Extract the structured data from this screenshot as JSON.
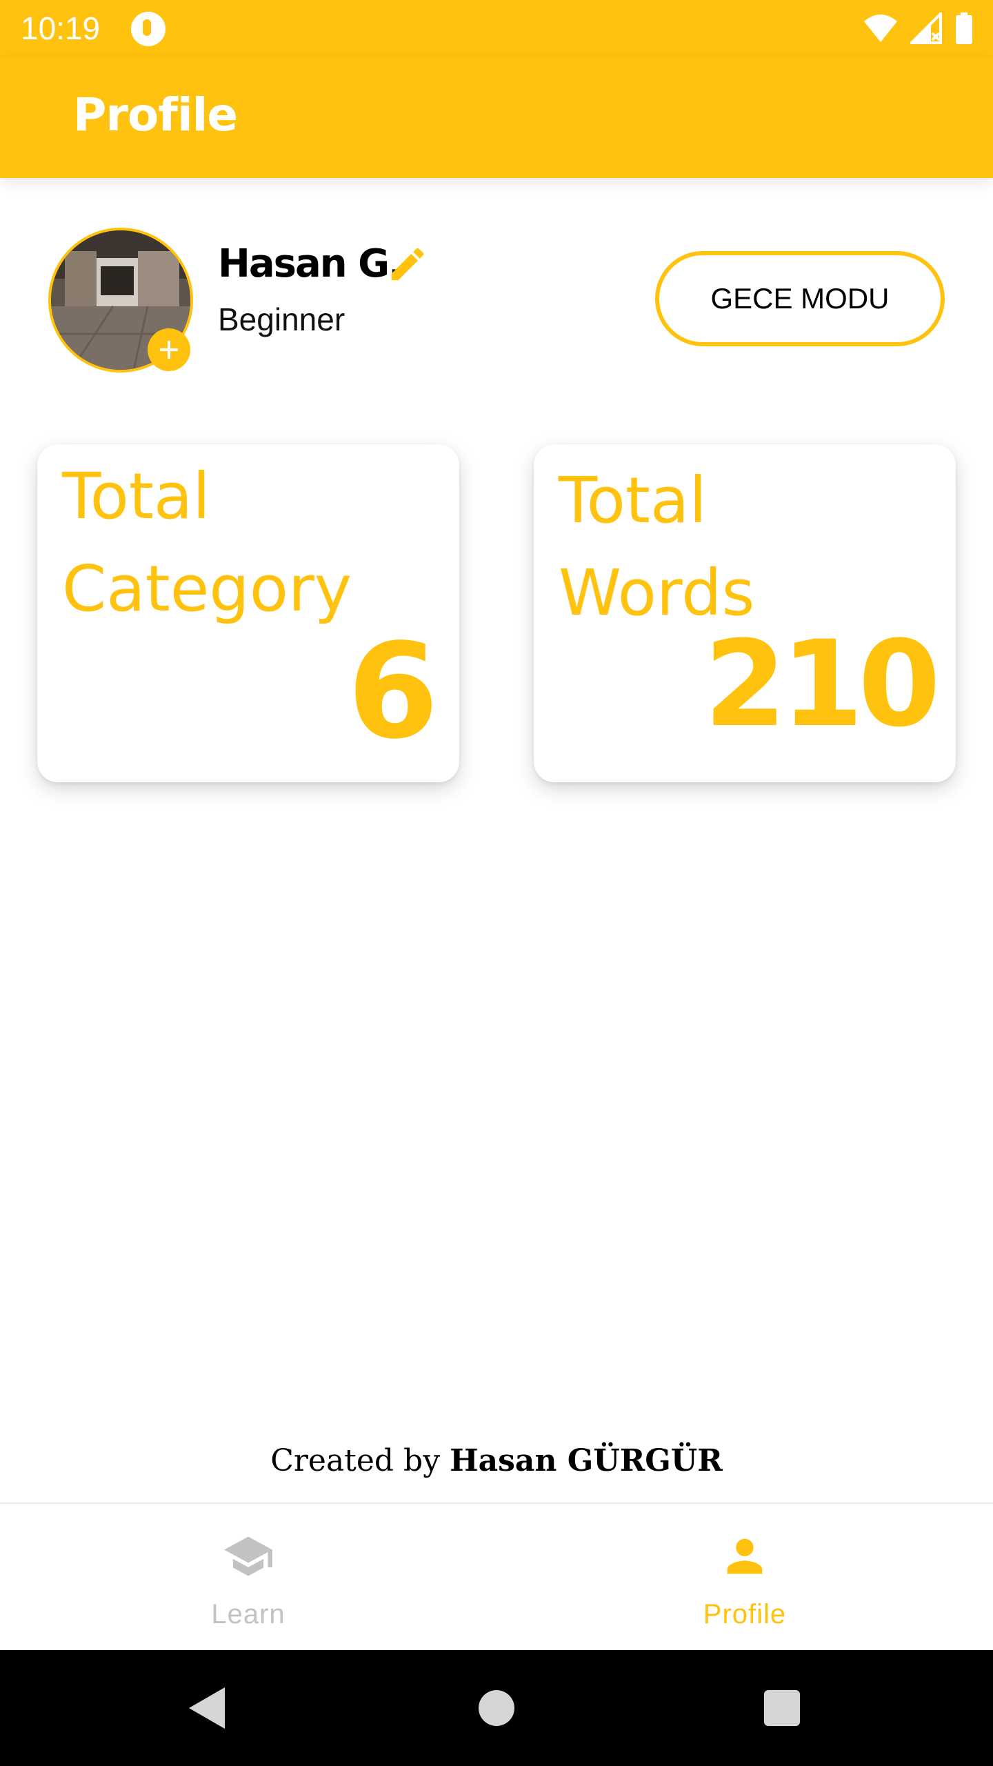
{
  "status_bar": {
    "time": "10:19",
    "icons": [
      "app-notification-icon",
      "wifi-icon",
      "signal-icon",
      "battery-icon"
    ]
  },
  "app_bar": {
    "title": "Profile"
  },
  "profile": {
    "name": "Hasan G.",
    "level": "Beginner",
    "night_mode_button": "GECE MODU"
  },
  "stats": {
    "category": {
      "label_line1": "Total",
      "label_line2": "Category",
      "value": "6"
    },
    "words": {
      "label_line1": "Total",
      "label_line2": "Words",
      "value": "210"
    }
  },
  "footer": {
    "created_prefix": "Created by",
    "author": "Hasan GÜRGÜR"
  },
  "bottom_nav": {
    "items": [
      {
        "label": "Learn",
        "icon": "graduation-cap-icon",
        "active": false
      },
      {
        "label": "Profile",
        "icon": "person-icon",
        "active": true
      }
    ]
  },
  "colors": {
    "accent": "#FFC20E",
    "inactive": "#C2C2C2"
  }
}
